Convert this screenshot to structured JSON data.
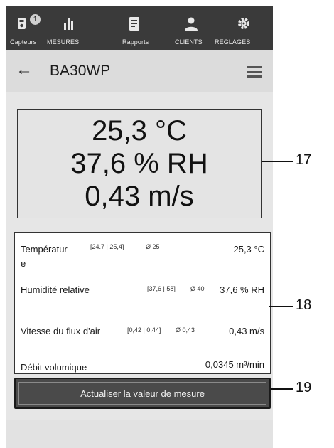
{
  "tabs": [
    {
      "label": "Capteurs",
      "icon": "sensor-icon",
      "badge": "1"
    },
    {
      "label": "MESURES",
      "icon": "bar-chart-icon"
    },
    {
      "label": "Rapports",
      "icon": "report-icon"
    },
    {
      "label": "CLIENTS",
      "icon": "person-icon"
    },
    {
      "label": "REGLAGES",
      "icon": "gear-icon"
    }
  ],
  "header": {
    "title": "BA30WP",
    "back_icon": "arrow-left-icon",
    "menu_icon": "hamburger-menu-icon"
  },
  "display": {
    "line1": "25,3 °C",
    "line2": "37,6 % RH",
    "line3": "0,43 m/s"
  },
  "rows": [
    {
      "label_a": "Températur",
      "label_b": "e",
      "range": "[24.7 | 25,4]",
      "avg": "Ø 25",
      "value": "25,3 °C"
    },
    {
      "label": "Humidité relative",
      "range": "[37,6 | 58]",
      "avg": "Ø 40",
      "value": "37,6 % RH"
    },
    {
      "label": "Vitesse du flux d'air",
      "range": "[0,42 | 0,44]",
      "avg": "Ø 0,43",
      "value": "0,43 m/s"
    },
    {
      "label": "Débit volumique",
      "value": "0,0345 m³/min"
    }
  ],
  "button": {
    "label": "Actualiser la valeur de mesure"
  },
  "callouts": [
    "17",
    "18",
    "19"
  ]
}
